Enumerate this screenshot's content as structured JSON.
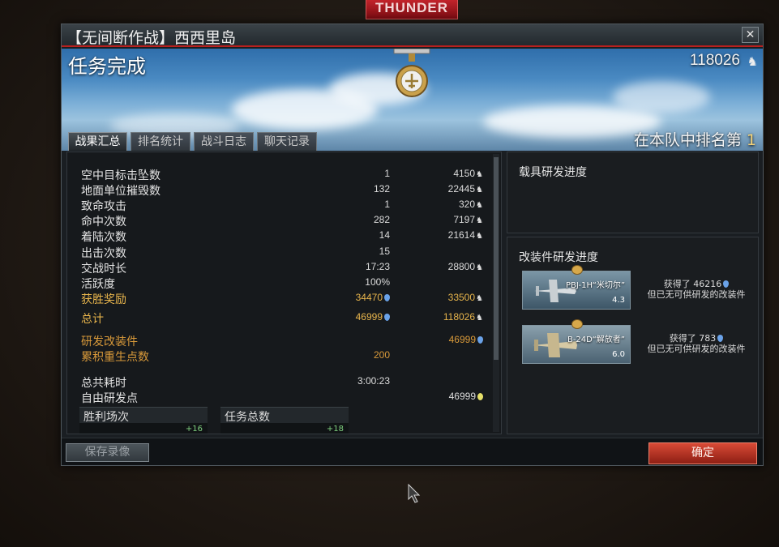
{
  "bg_logo": "THUNDER",
  "window": {
    "title": "【无间断作战】西西里岛",
    "close": "✕"
  },
  "banner": {
    "heading": "任务完成",
    "score": "118026",
    "rank_label": "在本队中排名第",
    "rank_value": "1"
  },
  "tabs": [
    "战果汇总",
    "排名统计",
    "战斗日志",
    "聊天记录"
  ],
  "stats": [
    {
      "label": "空中目标击坠数",
      "count": "1",
      "reward": "4150",
      "reward_icon": "lion"
    },
    {
      "label": "地面单位摧毁数",
      "count": "132",
      "reward": "22445",
      "reward_icon": "lion"
    },
    {
      "label": "致命攻击",
      "count": "1",
      "reward": "320",
      "reward_icon": "lion"
    },
    {
      "label": "命中次数",
      "count": "282",
      "reward": "7197",
      "reward_icon": "lion"
    },
    {
      "label": "着陆次数",
      "count": "14",
      "reward": "21614",
      "reward_icon": "lion"
    },
    {
      "label": "出击次数",
      "count": "15",
      "reward": "",
      "reward_icon": ""
    },
    {
      "label": "交战时长",
      "count": "17:23",
      "reward": "28800",
      "reward_icon": "lion"
    },
    {
      "label": "活跃度",
      "count": "100%",
      "reward": "",
      "reward_icon": ""
    },
    {
      "label": "获胜奖励",
      "count": "34470",
      "count_icon": "rp",
      "reward": "33500",
      "reward_icon": "lion",
      "style": "gold"
    },
    {
      "label": "总计",
      "count": "46999",
      "count_icon": "rp",
      "reward": "118026",
      "reward_icon": "lion",
      "style": "gold"
    },
    {
      "label": "研发改装件",
      "count": "",
      "reward": "46999",
      "reward_icon": "rp",
      "style": "orange"
    },
    {
      "label": "累积重生点数",
      "count": "200",
      "reward": "",
      "reward_icon": "",
      "style": "orange"
    },
    {
      "label": "总共耗时",
      "count": "3:00:23",
      "reward": "",
      "reward_icon": ""
    },
    {
      "label": "自由研发点",
      "count": "",
      "reward": "46999",
      "reward_icon": "free"
    }
  ],
  "subboxes": [
    {
      "title": "胜利场次",
      "delta": "+16"
    },
    {
      "title": "任务总数",
      "delta": "+18"
    }
  ],
  "research": {
    "title": "载具研发进度"
  },
  "mods": {
    "title": "改装件研发进度",
    "units": [
      {
        "name": "PBJ-1H“米切尔”",
        "br": "4.3",
        "line1": "获得了 46216",
        "line2": "但已无可供研发的改装件"
      },
      {
        "name": "B-24D“解放者”",
        "br": "6.0",
        "line1": "获得了 783",
        "line2": "但已无可供研发的改装件"
      }
    ]
  },
  "buttons": {
    "replay": "保存录像",
    "ok": "确定"
  },
  "colors": {
    "accent_red": "#b8201e",
    "gold": "#e8b54c",
    "rp_blue": "#6aa2e8"
  }
}
